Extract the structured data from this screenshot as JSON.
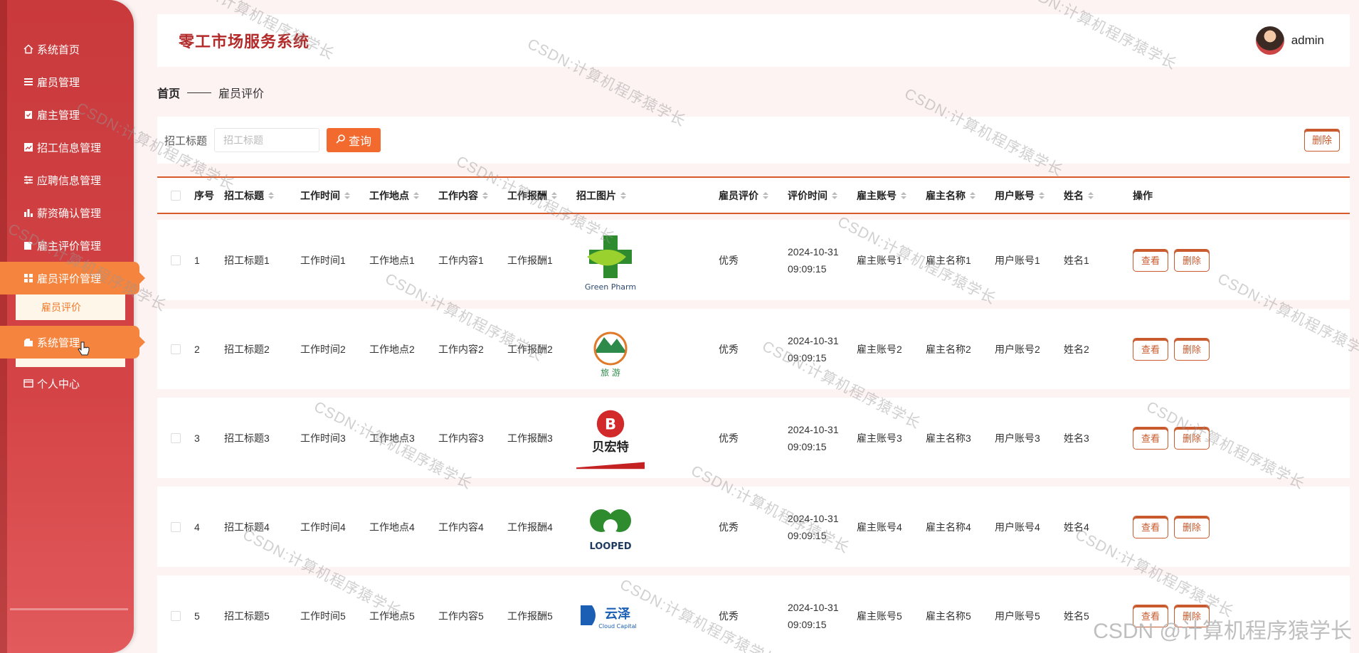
{
  "app": {
    "title": "零工市场服务系统",
    "user": "admin"
  },
  "sidebar": {
    "items": [
      {
        "label": "系统首页",
        "icon": "home-icon"
      },
      {
        "label": "雇员管理",
        "icon": "list-icon"
      },
      {
        "label": "雇主管理",
        "icon": "clipboard-icon"
      },
      {
        "label": "招工信息管理",
        "icon": "chart-icon"
      },
      {
        "label": "应聘信息管理",
        "icon": "sliders-icon"
      },
      {
        "label": "薪资确认管理",
        "icon": "bar-icon"
      },
      {
        "label": "雇主评价管理",
        "icon": "edit-icon"
      },
      {
        "label": "雇员评价管理",
        "icon": "grid-icon"
      },
      {
        "label": "系统管理",
        "icon": "folder-icon"
      },
      {
        "label": "个人中心",
        "icon": "card-icon"
      }
    ],
    "submenu_label": "雇员评价"
  },
  "breadcrumb": {
    "home": "首页",
    "current": "雇员评价"
  },
  "search": {
    "label": "招工标题",
    "placeholder": "招工标题",
    "button": "查询",
    "delete": "删除"
  },
  "table": {
    "headers": [
      "序号",
      "招工标题",
      "工作时间",
      "工作地点",
      "工作内容",
      "工作报酬",
      "招工图片",
      "雇员评价",
      "评价时间",
      "雇主账号",
      "雇主名称",
      "用户账号",
      "姓名",
      "操作"
    ],
    "view_label": "查看",
    "delete_label": "删除",
    "rows": [
      {
        "idx": "1",
        "title": "招工标题1",
        "time": "工作时间1",
        "loc": "工作地点1",
        "content": "工作内容1",
        "pay": "工作报酬1",
        "logo": "Green Pharm",
        "eval": "优秀",
        "rtime": "2024-10-31 09:09:15",
        "eacc": "雇主账号1",
        "ename": "雇主名称1",
        "uacc": "用户账号1",
        "name": "姓名1"
      },
      {
        "idx": "2",
        "title": "招工标题2",
        "time": "工作时间2",
        "loc": "工作地点2",
        "content": "工作内容2",
        "pay": "工作报酬2",
        "logo": "旅 游",
        "eval": "优秀",
        "rtime": "2024-10-31 09:09:15",
        "eacc": "雇主账号2",
        "ename": "雇主名称2",
        "uacc": "用户账号2",
        "name": "姓名2"
      },
      {
        "idx": "3",
        "title": "招工标题3",
        "time": "工作时间3",
        "loc": "工作地点3",
        "content": "工作内容3",
        "pay": "工作报酬3",
        "logo": "贝宏特",
        "eval": "优秀",
        "rtime": "2024-10-31 09:09:15",
        "eacc": "雇主账号3",
        "ename": "雇主名称3",
        "uacc": "用户账号3",
        "name": "姓名3"
      },
      {
        "idx": "4",
        "title": "招工标题4",
        "time": "工作时间4",
        "loc": "工作地点4",
        "content": "工作内容4",
        "pay": "工作报酬4",
        "logo": "LOOPED",
        "eval": "优秀",
        "rtime": "2024-10-31 09:09:15",
        "eacc": "雇主账号4",
        "ename": "雇主名称4",
        "uacc": "用户账号4",
        "name": "姓名4"
      },
      {
        "idx": "5",
        "title": "招工标题5",
        "time": "工作时间5",
        "loc": "工作地点5",
        "content": "工作内容5",
        "pay": "工作报酬5",
        "logo": "云泽 Cloud Capital",
        "eval": "优秀",
        "rtime": "2024-10-31 09:09:15",
        "eacc": "雇主账号5",
        "ename": "雇主名称5",
        "uacc": "用户账号5",
        "name": "姓名5"
      }
    ]
  },
  "watermark": {
    "text": "CSDN:计算机程序猿学长",
    "footer": "CSDN @计算机程序猿学长"
  },
  "colors": {
    "sidebar": "#c93a3c",
    "accent": "#f26a2d",
    "title": "#b32a2a"
  }
}
